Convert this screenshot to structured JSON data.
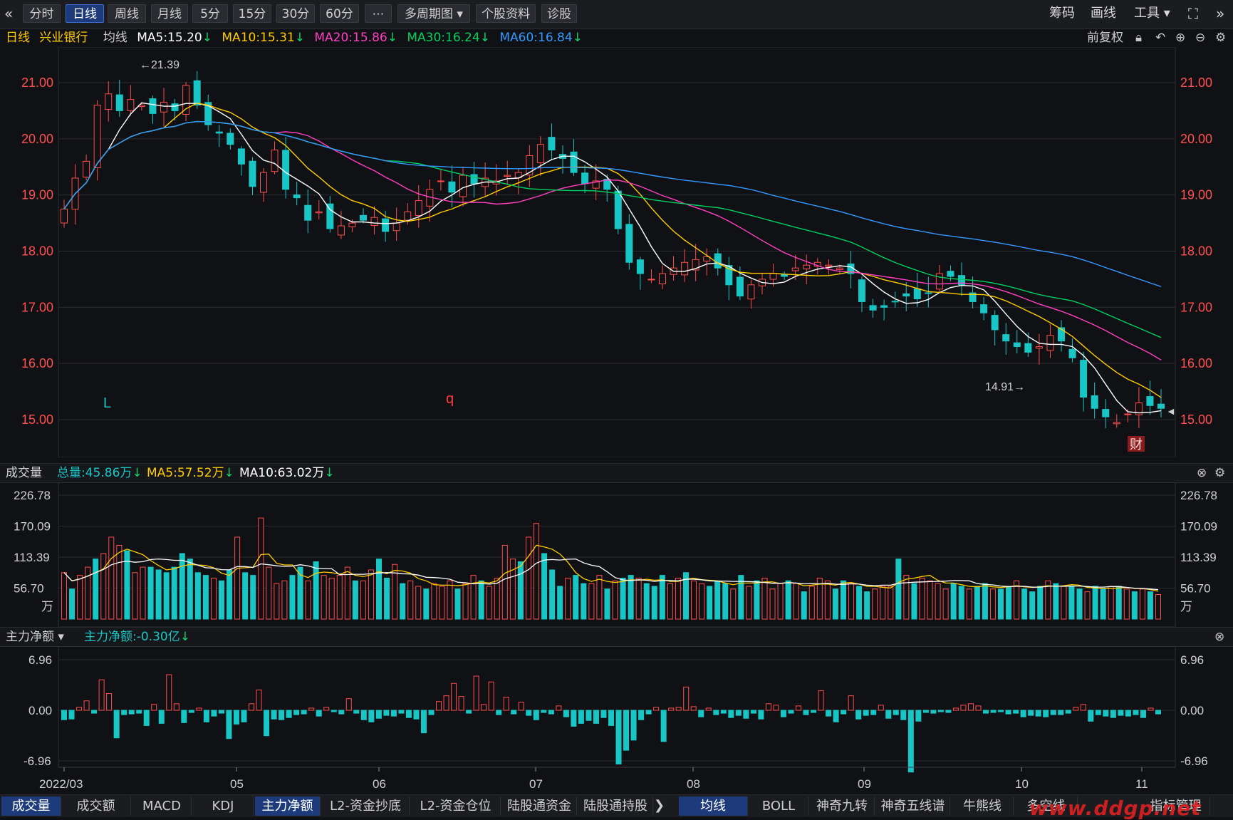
{
  "toolbar": {
    "nav_icon": "double-chevron-left-icon",
    "buttons": [
      "分时",
      "日线",
      "周线",
      "月线",
      "5分",
      "15分",
      "30分",
      "60分",
      "⋯",
      "多周期图 ▾",
      "个股资料",
      "诊股"
    ],
    "active_button": "日线",
    "right": [
      "筹码",
      "画线",
      "工具 ▾"
    ]
  },
  "legend_main": {
    "period": "日线",
    "stock": "兴业银行",
    "ma_title": "均线",
    "ma5": "MA5:15.20",
    "ma10": "MA10:15.31",
    "ma20": "MA20:15.86",
    "ma30": "MA30:16.24",
    "ma60": "MA60:16.84",
    "adjust": "前复权"
  },
  "legend_volume": {
    "title": "成交量",
    "total": "总量:45.86万",
    "ma5": "MA5:57.52万",
    "ma10": "MA10:63.02万"
  },
  "legend_flow": {
    "title": "主力净额 ▾",
    "value": "主力净额:-0.30亿"
  },
  "colors": {
    "up": "#ff4d4d",
    "down": "#19c6c6",
    "ma5": "#ffffff",
    "ma10": "#ffcc00",
    "ma20": "#ff40c0",
    "ma30": "#00d060",
    "ma60": "#3399ff",
    "axis": "#ff5050"
  },
  "markers": {
    "high": "←21.39",
    "low": "14.91→",
    "mark_l": "L",
    "mark_q": "q",
    "cai": "财"
  },
  "chart_data": [
    {
      "type": "candlestick",
      "title": "兴业银行 日线",
      "ylim": [
        14.4,
        21.6
      ],
      "ytick_labels": [
        "21.00",
        "20.00",
        "19.00",
        "18.00",
        "17.00",
        "16.00",
        "15.00"
      ],
      "x_tick_labels": [
        "2022/03",
        "05",
        "06",
        "07",
        "08",
        "09",
        "10",
        "11"
      ],
      "close_approx": [
        18.75,
        19.3,
        19.6,
        20.6,
        20.8,
        20.5,
        20.7,
        20.6,
        20.45,
        20.65,
        20.5,
        20.95,
        20.6,
        20.25,
        20.1,
        19.9,
        19.55,
        19.15,
        19.4,
        19.8,
        19.1,
        18.95,
        18.55,
        18.7,
        18.4,
        18.45,
        18.5,
        18.55,
        18.6,
        18.35,
        18.5,
        18.7,
        18.9,
        19.1,
        19.25,
        19.05,
        19.35,
        19.2,
        19.3,
        19.25,
        19.35,
        19.4,
        19.7,
        19.9,
        19.8,
        19.65,
        19.4,
        19.2,
        19.25,
        19.1,
        18.4,
        17.8,
        17.6,
        17.5,
        17.6,
        17.7,
        17.8,
        17.85,
        17.9,
        17.7,
        17.4,
        17.2,
        17.4,
        17.5,
        17.6,
        17.55,
        17.7,
        17.75,
        17.8,
        17.75,
        17.7,
        17.6,
        17.1,
        16.95,
        17.0,
        17.1,
        17.2,
        17.15,
        17.25,
        17.6,
        17.55,
        17.4,
        17.1,
        16.9,
        16.6,
        16.4,
        16.3,
        16.2,
        16.3,
        16.5,
        16.4,
        16.1,
        15.4,
        15.2,
        15.05,
        14.95,
        15.1,
        15.3,
        15.25,
        15.2
      ],
      "series": [
        {
          "name": "MA5",
          "values_last": 15.2
        },
        {
          "name": "MA10",
          "values_last": 15.31
        },
        {
          "name": "MA20",
          "values_last": 15.86
        },
        {
          "name": "MA30",
          "values_last": 16.24
        },
        {
          "name": "MA60",
          "values_last": 16.84
        }
      ],
      "annotations": [
        "←21.39",
        "14.91→"
      ]
    },
    {
      "type": "bar",
      "title": "成交量",
      "unit": "万",
      "ylim": [
        0,
        226.78
      ],
      "ytick_labels": [
        "226.78",
        "170.09",
        "113.39",
        "56.70",
        "万"
      ],
      "values": [
        85,
        55,
        80,
        95,
        110,
        120,
        150,
        135,
        125,
        85,
        95,
        95,
        90,
        85,
        95,
        120,
        110,
        85,
        80,
        75,
        70,
        90,
        150,
        85,
        80,
        185,
        95,
        65,
        70,
        80,
        95,
        70,
        105,
        80,
        75,
        80,
        95,
        70,
        70,
        90,
        110,
        75,
        100,
        65,
        70,
        60,
        55,
        65,
        60,
        70,
        55,
        65,
        80,
        70,
        60,
        75,
        135,
        110,
        105,
        150,
        175,
        120,
        90,
        60,
        75,
        80,
        65,
        65,
        80,
        55,
        70,
        75,
        80,
        75,
        65,
        60,
        80,
        65,
        75,
        85,
        70,
        65,
        60,
        70,
        65,
        55,
        80,
        60,
        70,
        75,
        55,
        65,
        70,
        65,
        50,
        60,
        75,
        70,
        55,
        70,
        65,
        60,
        50,
        55,
        60,
        60,
        110,
        80,
        65,
        75,
        70,
        65,
        55,
        65,
        60,
        55,
        60,
        65,
        55,
        55,
        60,
        70,
        55,
        50,
        60,
        70,
        65,
        60,
        60,
        55,
        50,
        60,
        55,
        60,
        60,
        55,
        50,
        55,
        50,
        45
      ],
      "series": [
        {
          "name": "MA5",
          "values_last": 57.52
        },
        {
          "name": "MA10",
          "values_last": 63.02
        }
      ]
    },
    {
      "type": "bar",
      "title": "主力净额",
      "unit": "亿",
      "ylim": [
        -6.96,
        6.96
      ],
      "ytick_labels": [
        "6.96",
        "0.00",
        "-6.96"
      ],
      "values": [
        -1.3,
        -1.2,
        0.4,
        1.3,
        -0.4,
        4.2,
        2.3,
        -3.8,
        -0.6,
        -0.5,
        -0.4,
        -2.1,
        0.8,
        -1.8,
        4.9,
        0.9,
        -1.7,
        -0.3,
        0.3,
        -1.6,
        -0.8,
        -0.4,
        -3.9,
        -1.9,
        -1.6,
        0.9,
        2.8,
        -3.5,
        -1.2,
        -1.3,
        -1.0,
        -0.6,
        -0.5,
        0.3,
        -0.8,
        0.4,
        -0.2,
        -0.5,
        1.6,
        -0.4,
        -1.3,
        -1.6,
        -1.1,
        -0.7,
        -0.8,
        -0.4,
        -1.0,
        -1.2,
        -3.1,
        -0.6,
        1.2,
        2.0,
        3.7,
        1.9,
        -0.4,
        4.7,
        0.8,
        3.9,
        -0.6,
        1.8,
        -0.5,
        1.1,
        -0.7,
        -1.3,
        -0.3,
        -0.5,
        0.6,
        -0.9,
        -2.2,
        -1.8,
        -1.4,
        -1.8,
        -1.0,
        -2.1,
        -7.4,
        -5.5,
        -4.1,
        -1.3,
        -0.5,
        0.4,
        -4.3,
        0.3,
        0.4,
        3.2,
        0.5,
        -0.9,
        0.3,
        -0.6,
        -0.4,
        -1.0,
        -0.7,
        -1.1,
        -0.4,
        -1.2,
        0.9,
        0.7,
        -0.9,
        -0.4,
        0.6,
        -0.6,
        -0.3,
        2.7,
        -0.8,
        -1.6,
        -0.5,
        2.0,
        -1.2,
        -0.7,
        -0.6,
        0.7,
        -1.1,
        -0.6,
        -1.3,
        -8.5,
        -1.5,
        -0.3,
        -0.4,
        -0.2,
        -0.3,
        0.3,
        0.7,
        0.9,
        0.6,
        -0.4,
        -0.3,
        -0.2,
        -0.5,
        -0.4,
        -0.9,
        -0.7,
        -0.8,
        -0.9,
        -0.6,
        -0.6,
        -0.4,
        0.4,
        0.8,
        -1.5,
        -0.6,
        -0.8,
        -1.0,
        -0.7,
        -0.8,
        -0.6,
        -1.0,
        0.3,
        -0.5
      ]
    }
  ],
  "bottom_tabs_left": [
    "成交量",
    "成交额",
    "MACD",
    "KDJ",
    "主力净额",
    "L2-资金抄底",
    "L2-资金仓位",
    "陆股通资金",
    "陆股通持股"
  ],
  "bottom_tabs_right": [
    "均线",
    "BOLL",
    "神奇九转",
    "神奇五线谱",
    "牛熊线",
    "多空线",
    "指标管理"
  ],
  "watermark": "www.ddgp.net"
}
